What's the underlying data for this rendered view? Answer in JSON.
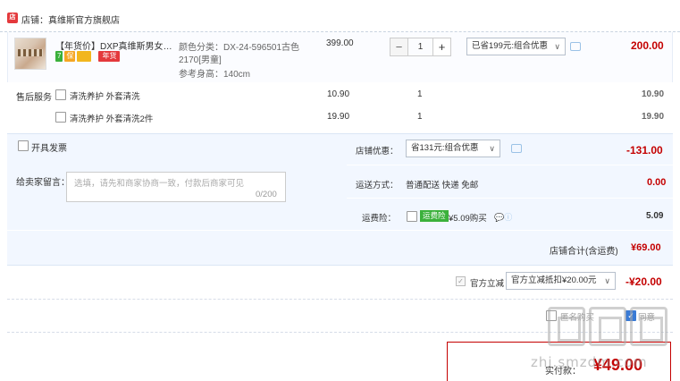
{
  "shop": {
    "icon": "shop-icon",
    "label": "店铺：真维斯官方旗舰店"
  },
  "item": {
    "title": "【年货价】DXP真维斯男女童夏装卡通印花短袖",
    "badges": {
      "seven": "7",
      "bao": "保",
      "nianhuo": "年货"
    },
    "sku_color": "颜色分类：DX-24-596501古色",
    "sku_size": "2170[男童]",
    "sku_height": "参考身高：140cm",
    "unit_price": "399.00",
    "qty": "1",
    "qty_minus": "−",
    "qty_plus": "+",
    "promo_select": "已省199元:组合优惠",
    "total": "200.00"
  },
  "services": {
    "label": "售后服务",
    "rows": [
      {
        "name": "清洗养护 外套清洗",
        "price": "10.90",
        "qty": "1",
        "total": "10.90"
      },
      {
        "name": "清洗养护 外套清洗2件",
        "price": "19.90",
        "qty": "1",
        "total": "19.90"
      }
    ]
  },
  "invoice": {
    "label": "开具发票"
  },
  "message": {
    "label": "给卖家留言：",
    "placeholder": "选填，请先和商家协商一致，付款后商家可见",
    "count": "0/200"
  },
  "shop_discount": {
    "label": "店铺优惠：",
    "select": "省131元:组合优惠",
    "value": "-131.00"
  },
  "shipping": {
    "label": "运送方式：",
    "method": "普通配送 快递 免邮",
    "value": "0.00"
  },
  "insurance": {
    "label": "运费险：",
    "badge": "运费险",
    "text": "¥5.09购买",
    "icons": "💬ⓘ",
    "value": "5.09"
  },
  "shop_total": {
    "label": "店铺合计(含运费)",
    "value": "¥69.00"
  },
  "official": {
    "label": "官方立减",
    "select": "官方立减抵扣¥20.00元",
    "value": "-¥20.00"
  },
  "footer": {
    "anon_label": "匿名购买",
    "agree_label": "同意",
    "pay_label": "实付款：",
    "pay_value": "¥49.00"
  },
  "watermark": {
    "text": "zhi.smzdm.com"
  },
  "colors": {
    "accent_red": "#c40000",
    "panel_blue": "#f2f7ff",
    "green_badge": "#3bb13b"
  }
}
